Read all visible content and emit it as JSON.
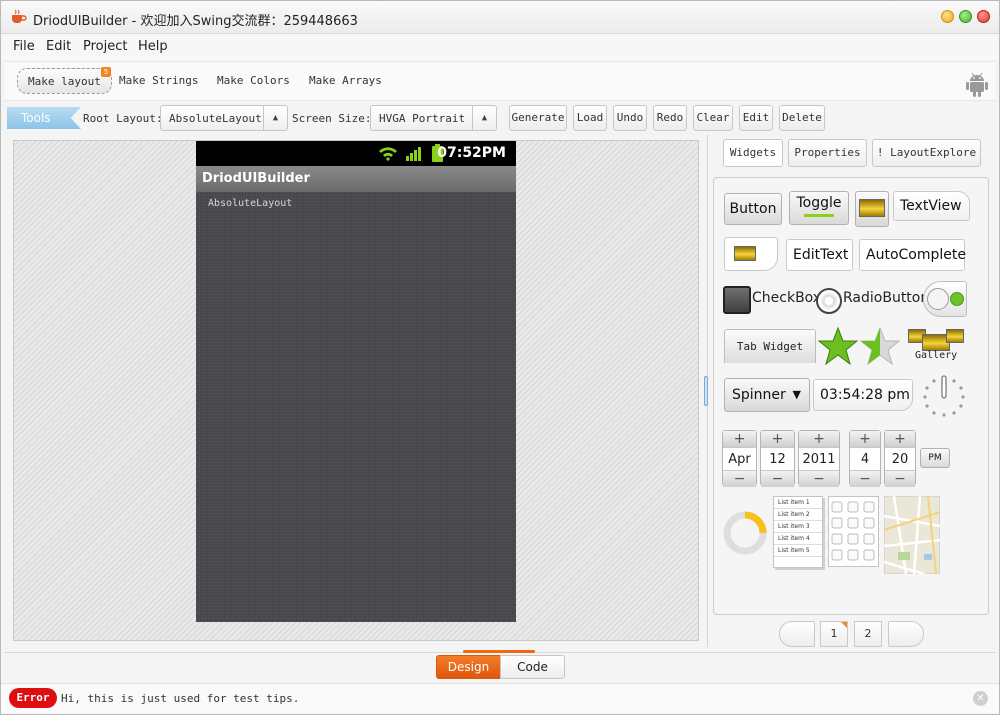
{
  "window": {
    "title": "DriodUIBuilder - 欢迎加入Swing交流群：259448663"
  },
  "menu": [
    "File",
    "Edit",
    "Project",
    "Help"
  ],
  "make_tabs": [
    {
      "label": "Make layout",
      "active": true
    },
    {
      "label": "Make Strings",
      "active": false
    },
    {
      "label": "Make Colors",
      "active": false
    },
    {
      "label": "Make Arrays",
      "active": false
    }
  ],
  "tools": {
    "tab_label": "Tools",
    "root_layout_label": "Root Layout:",
    "root_layout_value": "AbsoluteLayout",
    "screen_size_label": "Screen Size:",
    "screen_size_value": "HVGA Portrait",
    "buttons": [
      "Generate",
      "Load",
      "Undo",
      "Redo",
      "Clear",
      "Edit",
      "Delete"
    ]
  },
  "phone": {
    "clock": "07:52PM",
    "app_title": "DriodUIBuilder",
    "layout_label": "AbsoluteLayout"
  },
  "right_tabs": [
    "Widgets",
    "Properties",
    "! LayoutExplore"
  ],
  "widgets": {
    "button": "Button",
    "toggle": "Toggle",
    "textview": "TextView",
    "edittext": "EditText",
    "autocomplete": "AutoComplete",
    "checkbox": "CheckBox",
    "radiobutton": "RadioButton",
    "tab_widget": "Tab Widget",
    "gallery": "Gallery",
    "spinner": "Spinner",
    "time": "03:54:28 pm",
    "date": [
      "Apr",
      "12",
      "2011"
    ],
    "time_picker": [
      "4",
      "20"
    ],
    "ampm": "PM",
    "list_items": [
      "List item 1",
      "List item 2",
      "List item 3",
      "List item 4",
      "List item 5"
    ]
  },
  "pagination": {
    "pages": [
      "1",
      "2"
    ],
    "current": "1"
  },
  "bottom": {
    "design_label": "Design",
    "code_label": "Code"
  },
  "status": {
    "badge": "Error",
    "message": "Hi, this is just used for test tips."
  }
}
